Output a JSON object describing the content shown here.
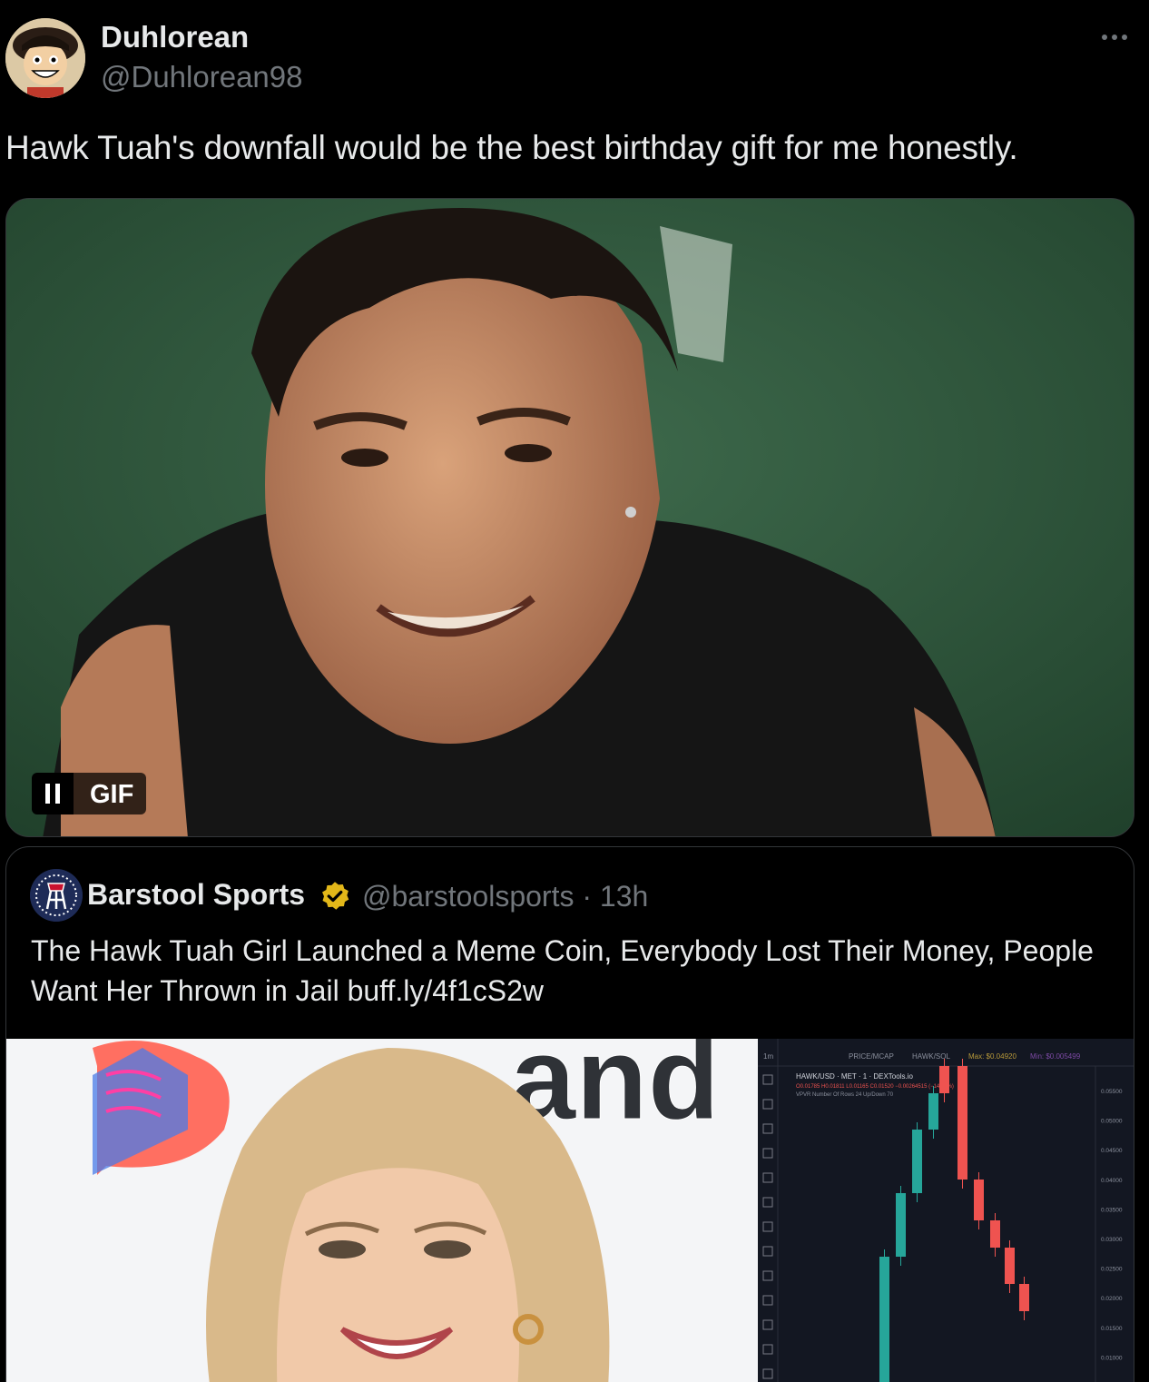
{
  "tweet": {
    "author_name": "Duhlorean",
    "author_handle": "@Duhlorean98",
    "text": "Hawk Tuah's downfall would be the best birthday gift for me honestly.",
    "media": {
      "type": "gif",
      "badge_label": "GIF"
    }
  },
  "quoted_tweet": {
    "author_name": "Barstool Sports",
    "verified": true,
    "author_handle": "@barstoolsports",
    "separator": "·",
    "time": "13h",
    "text": "The Hawk Tuah Girl Launched a Meme Coin, Everybody Lost Their Money, People Want Her Thrown in Jail buff.ly/4f1cS2w",
    "photo_backdrop_text": "and",
    "chart": {
      "toolbar_interval": "1m",
      "toolbar_tabs": [
        "PRICE/MCAP",
        "HAWK/SOL"
      ],
      "max_label": "Max: $0.04920",
      "min_label": "Min: $0.005499",
      "pair_title": "HAWK/USD · MET · 1 · DEXTools.io",
      "ohlc_line": "O0.01785 H0.01811 L0.01165 C0.01520 −0.00264515 (−14.82%)",
      "volume_line": "VPVR Number Of Rows 24 Up/Down 70",
      "y_ticks": [
        "0.05500",
        "0.05000",
        "0.04500",
        "0.04000",
        "0.03500",
        "0.03000",
        "0.02500",
        "0.02000",
        "0.01500",
        "0.01000"
      ]
    }
  },
  "colors": {
    "background": "#000000",
    "text_primary": "#e7e9ea",
    "text_secondary": "#71767b",
    "verified_gold": "#e2b719",
    "candle_up": "#26a69a",
    "candle_down": "#ef5350"
  }
}
